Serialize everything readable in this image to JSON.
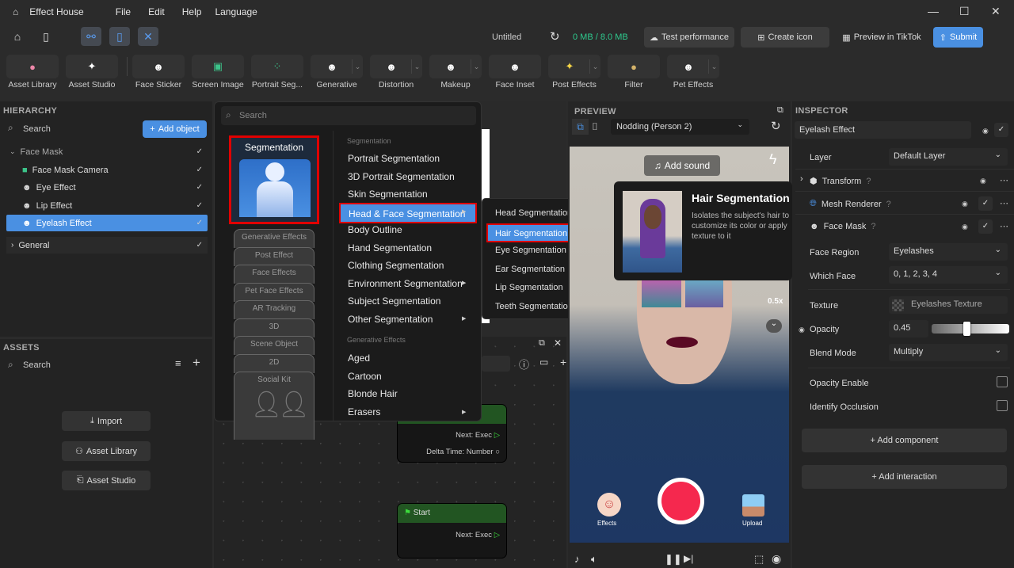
{
  "app": {
    "title": "Effect House",
    "menu": [
      "File",
      "Edit",
      "Help",
      "Language"
    ]
  },
  "toolbar": {
    "project": "Untitled",
    "storage": "0 MB / 8.0 MB",
    "test_performance": "Test performance",
    "create_icon": "Create icon",
    "preview_tiktok": "Preview in TikTok",
    "submit": "Submit"
  },
  "tools": [
    {
      "label": "Asset Library",
      "icon": "●"
    },
    {
      "label": "Asset Studio",
      "icon": "✦"
    },
    {
      "label": "Face Sticker",
      "icon": "☻"
    },
    {
      "label": "Screen Image",
      "icon": "▣"
    },
    {
      "label": "Portrait Seg...",
      "icon": "⁘"
    },
    {
      "label": "Generative",
      "icon": "☻"
    },
    {
      "label": "Distortion",
      "icon": "☻"
    },
    {
      "label": "Makeup",
      "icon": "☻"
    },
    {
      "label": "Face Inset",
      "icon": "☻"
    },
    {
      "label": "Post Effects",
      "icon": "✦"
    },
    {
      "label": "Filter",
      "icon": "●"
    },
    {
      "label": "Pet Effects",
      "icon": "☻"
    }
  ],
  "hierarchy": {
    "title": "HIERARCHY",
    "search": "Search",
    "add_object": "Add object",
    "items": [
      "Face Mask",
      "Face Mask Camera",
      "Eye Effect",
      "Lip Effect",
      "Eyelash Effect",
      "General"
    ]
  },
  "assets": {
    "title": "ASSETS",
    "search": "Search",
    "import": "Import",
    "asset_library": "Asset Library",
    "asset_studio": "Asset Studio"
  },
  "add_menu": {
    "search_placeholder": "Search",
    "selected_category": "Segmentation",
    "categories": [
      "Generative Effects",
      "Post Effect",
      "Face Effects",
      "Pet Face Effects",
      "AR Tracking",
      "3D",
      "Scene Object",
      "2D",
      "Social Kit"
    ],
    "section1": "Segmentation",
    "items1": [
      "Portrait Segmentation",
      "3D Portrait Segmentation",
      "Skin Segmentation",
      "Head & Face Segmentation",
      "Body Outline",
      "Hand Segmentation",
      "Clothing Segmentation",
      "Environment Segmentation",
      "Subject Segmentation",
      "Other Segmentation"
    ],
    "section2": "Generative Effects",
    "items2": [
      "Aged",
      "Cartoon",
      "Blonde Hair",
      "Erasers"
    ]
  },
  "submenu": [
    "Head Segmentation",
    "Hair Segmentation",
    "Eye Segmentation",
    "Ear Segmentation",
    "Lip Segmentation",
    "Teeth Segmentation"
  ],
  "tooltip": {
    "title": "Hair Segmentation",
    "desc": "Isolates the subject's hair to customize its color or apply texture to it"
  },
  "preview": {
    "title": "PREVIEW",
    "scene": "Nodding (Person 2)",
    "add_sound": "Add sound",
    "speed": "0.5x",
    "effects": "Effects",
    "upload": "Upload"
  },
  "graph": {
    "node1": {
      "next": "Next: Exec",
      "delta": "Delta Time: Number"
    },
    "node2": {
      "title": "Start",
      "next": "Next: Exec"
    }
  },
  "inspector": {
    "title": "INSPECTOR",
    "object": "Eyelash Effect",
    "layer_label": "Layer",
    "layer": "Default Layer",
    "transform": "Transform",
    "mesh_renderer": "Mesh Renderer",
    "face_mask": "Face Mask",
    "face_region_label": "Face Region",
    "face_region": "Eyelashes",
    "which_face_label": "Which Face",
    "which_face": "0, 1, 2, 3, 4",
    "texture_label": "Texture",
    "texture": "Eyelashes Texture",
    "opacity_label": "Opacity",
    "opacity": "0.45",
    "opacity_value": 0.45,
    "blend_label": "Blend Mode",
    "blend": "Multiply",
    "opacity_enable": "Opacity Enable",
    "identify_occlusion": "Identify Occlusion",
    "add_component": "+ Add component",
    "add_interaction": "+ Add interaction"
  },
  "colors": {
    "accent": "#4a90e2",
    "highlight_border": "#e00000",
    "node_header": "#225522",
    "storage": "#2ecc8f"
  }
}
